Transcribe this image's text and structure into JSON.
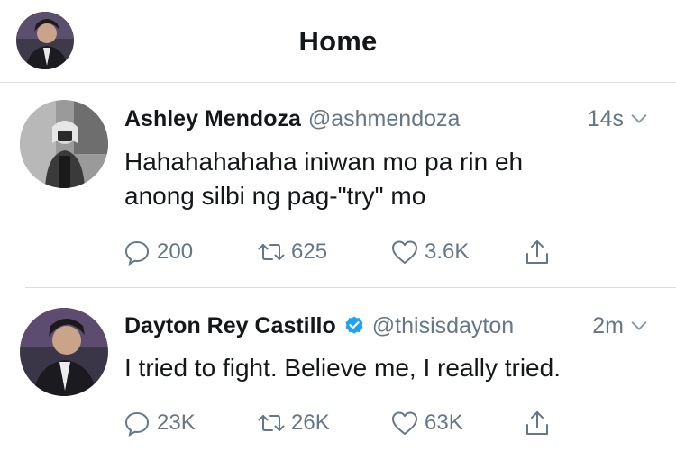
{
  "header": {
    "title": "Home"
  },
  "tweets": [
    {
      "name": "Ashley Mendoza",
      "handle": "@ashmendoza",
      "time": "14s",
      "verified": false,
      "text_line1": "Hahahahahaha iniwan mo pa rin eh",
      "text_line2": "anong silbi ng pag-\"try\" mo",
      "replies": "200",
      "retweets": "625",
      "likes": "3.6K"
    },
    {
      "name": "Dayton Rey Castillo",
      "handle": "@thisisdayton",
      "time": "2m",
      "verified": true,
      "text_line1": "I tried to fight. Believe me, I really tried.",
      "replies": "23K",
      "retweets": "26K",
      "likes": "63K"
    }
  ],
  "colors": {
    "muted": "#657786",
    "text": "#14171a",
    "verified": "#1da1f2",
    "divider": "#d8dde2"
  },
  "icons": [
    "reply-icon",
    "retweet-icon",
    "like-icon",
    "share-icon",
    "chevron-down-icon",
    "verified-badge-icon"
  ]
}
